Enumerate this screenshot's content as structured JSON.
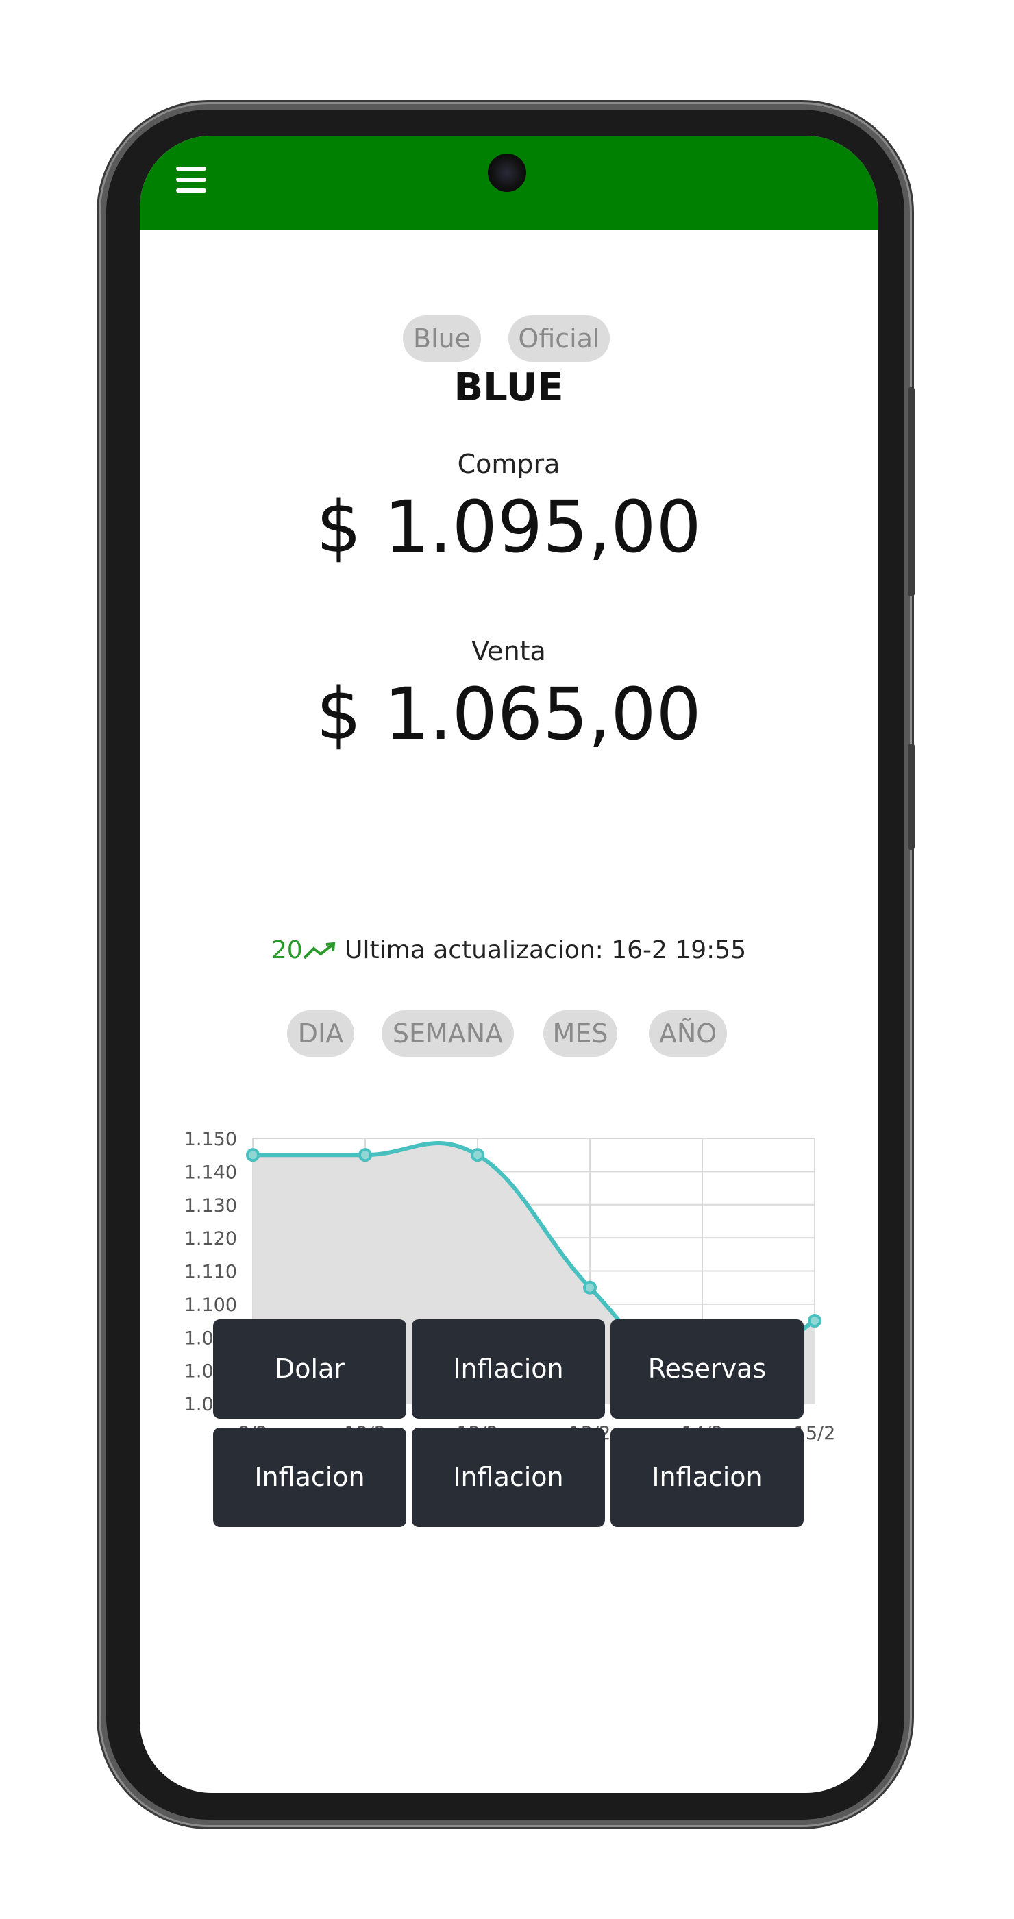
{
  "tabs": {
    "blue": "Blue",
    "oficial": "Oficial"
  },
  "currency_title": "BLUE",
  "compra": {
    "label": "Compra",
    "value": "$ 1.095,00"
  },
  "venta": {
    "label": "Venta",
    "value": "$ 1.065,00"
  },
  "update": {
    "count": "20",
    "trend_icon": "trending-up-icon",
    "text": "Ultima actualizacion: 16-2 19:55"
  },
  "ranges": {
    "dia": "DIA",
    "semana": "SEMANA",
    "mes": "MES",
    "anio": "AÑO"
  },
  "chart_data": {
    "type": "line",
    "x": [
      "8/2",
      "12/2",
      "12/2",
      "13/2",
      "14/2",
      "15/2"
    ],
    "values": [
      1145,
      1145,
      1145,
      1105,
      1075,
      1095
    ],
    "ylim": [
      1070,
      1150
    ],
    "yticks": [
      "1.150",
      "1.140",
      "1.130",
      "1.120",
      "1.110",
      "1.100",
      "1.090",
      "1.080",
      "1.070"
    ],
    "grid": true,
    "line_color": "#48c0bf",
    "fill_color": "#e0e0e0"
  },
  "buttons": [
    [
      "Dolar",
      "Inflacion",
      "Reservas"
    ],
    [
      "Inflacion",
      "Inflacion",
      "Inflacion"
    ]
  ],
  "colors": {
    "appbar": "#008000",
    "button_bg": "#292d36",
    "pill_bg": "#dcdcdc"
  }
}
